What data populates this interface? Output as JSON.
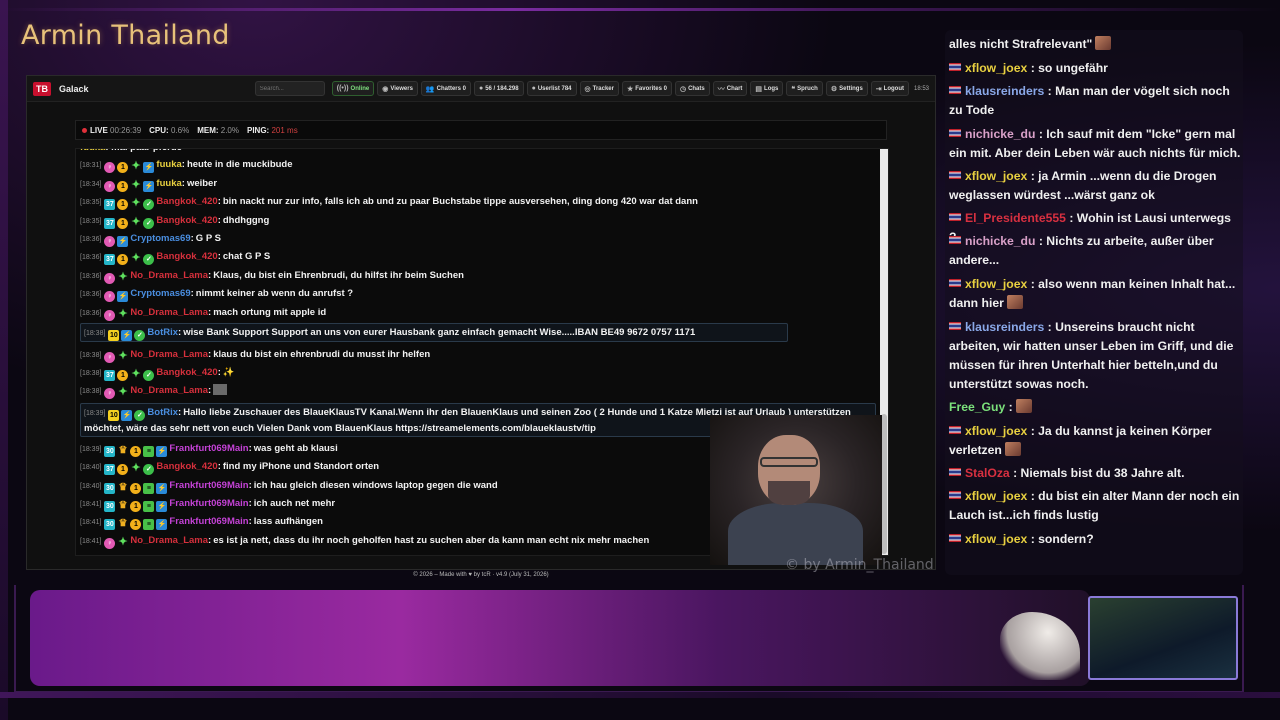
{
  "overlay": {
    "streamer_name": "Armin Thailand",
    "watermark": "© by Armin_Thailand"
  },
  "app": {
    "logo": "TB",
    "name": "Galack",
    "search_placeholder": "Search...",
    "nav": [
      {
        "label": "Online",
        "icon": "signal-icon"
      },
      {
        "label": "Viewers",
        "icon": "eye-icon"
      },
      {
        "label": "Chatters 0",
        "icon": "users-icon"
      },
      {
        "label": "56 / 184.298",
        "icon": "chat-bubble-icon"
      },
      {
        "label": "Userlist 784",
        "icon": "user-icon"
      },
      {
        "label": "Tracker",
        "icon": "target-icon"
      },
      {
        "label": "Favorites 0",
        "icon": "star-icon"
      },
      {
        "label": "Chats",
        "icon": "clock-icon"
      },
      {
        "label": "Chart",
        "icon": "chart-icon"
      },
      {
        "label": "Logs",
        "icon": "doc-icon"
      },
      {
        "label": "Spruch",
        "icon": "quote-icon"
      },
      {
        "label": "Settings",
        "icon": "gear-icon"
      },
      {
        "label": "Logout",
        "icon": "logout-icon"
      }
    ],
    "clock": "18:53",
    "status": {
      "live": "LIVE",
      "uptime": "00:26:39",
      "cpu_label": "CPU:",
      "cpu": "0.6%",
      "mem_label": "MEM:",
      "mem": "2.0%",
      "ping_label": "PING:",
      "ping": "201 ms"
    },
    "footer": "© 2026 – Made with ♥ by tcR · v4.9 (July 31, 2026)"
  },
  "chat": [
    {
      "ts": "[18:31]",
      "user": "fuuka",
      "color": "yellow",
      "text": "heute in die muckibude"
    },
    {
      "ts": "[18:34]",
      "user": "fuuka",
      "color": "yellow",
      "text": "weiber"
    },
    {
      "ts": "[18:35]",
      "user": "Bangkok_420",
      "color": "red",
      "text": "bin nackt nur zur info, falls ich ab und zu paar Buchstabe tippe ausversehen, ding dong 420 war dat dann"
    },
    {
      "ts": "[18:35]",
      "user": "Bangkok_420",
      "color": "red",
      "text": "dhdhggng"
    },
    {
      "ts": "[18:36]",
      "user": "Cryptomas69",
      "color": "blue",
      "text": "G P S"
    },
    {
      "ts": "[18:36]",
      "user": "Bangkok_420",
      "color": "red",
      "text": "chat G P S"
    },
    {
      "ts": "[18:36]",
      "user": "No_Drama_Lama",
      "color": "red",
      "text": "Klaus, du bist ein Ehrenbrudi, du hilfst ihr beim Suchen"
    },
    {
      "ts": "[18:36]",
      "user": "Cryptomas69",
      "color": "blue",
      "text": "nimmt keiner ab wenn du anrufst ?"
    },
    {
      "ts": "[18:36]",
      "user": "No_Drama_Lama",
      "color": "red",
      "text": "mach ortung mit apple id"
    },
    {
      "ts": "[18:38]",
      "user": "BotRix",
      "color": "blue",
      "text": "wise Bank Support Support an uns von eurer Hausbank ganz einfach gemacht Wise.....IBAN BE49 9672 0757 1171"
    },
    {
      "ts": "[18:38]",
      "user": "No_Drama_Lama",
      "color": "red",
      "text": "klaus du bist ein ehrenbrudi du musst ihr helfen"
    },
    {
      "ts": "[18:38]",
      "user": "Bangkok_420",
      "color": "red",
      "text": ""
    },
    {
      "ts": "[18:38]",
      "user": "No_Drama_Lama",
      "color": "red",
      "text": ""
    },
    {
      "ts": "[18:39]",
      "user": "BotRix",
      "color": "blue",
      "text": "Hallo liebe Zuschauer des BlaueKlausTV Kanal.Wenn ihr den BlauenKlaus und seinen Zoo ( 2 Hunde und 1 Katze Mietzi ist auf Urlaub ) unterstützen möchtet, wäre das sehr nett von euch Vielen Dank vom BlauenKlaus https://streamelements.com/blaueklaustv/tip"
    },
    {
      "ts": "[18:39]",
      "user": "Frankfurt069Main",
      "color": "purple",
      "text": "was geht ab klausi"
    },
    {
      "ts": "[18:40]",
      "user": "Bangkok_420",
      "color": "red",
      "text": "find my iPhone und Standort orten"
    },
    {
      "ts": "[18:40]",
      "user": "Frankfurt069Main",
      "color": "purple",
      "text": "ich hau gleich diesen windows laptop gegen die wand"
    },
    {
      "ts": "[18:41]",
      "user": "Frankfurt069Main",
      "color": "purple",
      "text": "ich auch net mehr"
    },
    {
      "ts": "[18:41]",
      "user": "Frankfurt069Main",
      "color": "purple",
      "text": "lass aufhängen"
    },
    {
      "ts": "[18:41]",
      "user": "No_Drama_Lama",
      "color": "red",
      "text": "es ist ja nett, dass du ihr noch geholfen hast zu suchen aber da kann man echt nix mehr machen"
    }
  ],
  "chat_partial_top": {
    "user": "fuuka",
    "text": "mal paar pferde"
  },
  "side_chat": [
    {
      "user": "",
      "text": "alles nicht Strafrelevant\"",
      "emote": true
    },
    {
      "user": "xflow_joex",
      "color": "yellow",
      "text": ": so ungefähr"
    },
    {
      "user": "klausreinders",
      "color": "blue",
      "text": ": Man man der vögelt sich noch zu Tode"
    },
    {
      "user": "nichicke_du",
      "color": "pink",
      "text": ": Ich sauf mit dem \"Icke\" gern mal ein mit. Aber dein Leben wär auch nichts für mich."
    },
    {
      "user": "xflow_joex",
      "color": "yellow",
      "text": ": ja Armin ...wenn du die Drogen weglassen würdest ...wärst ganz ok"
    },
    {
      "user": "El_Presidente555",
      "color": "red",
      "text": ": Wohin ist Lausi unterwegs ?"
    },
    {
      "user": "nichicke_du",
      "color": "pink",
      "text": ": Nichts zu arbeite, außer über andere..."
    },
    {
      "user": "xflow_joex",
      "color": "yellow",
      "text": ": also wenn man keinen Inhalt hat... dann hier",
      "emote": true
    },
    {
      "user": "klausreinders",
      "color": "blue",
      "text": ": Unsereins braucht nicht arbeiten, wir hatten unser Leben im Griff, und die müssen für ihren Unterhalt hier betteln,und du unterstützt sowas noch."
    },
    {
      "user": "Free_Guy",
      "color": "green",
      "text": ":",
      "emote": true
    },
    {
      "user": "xflow_joex",
      "color": "yellow",
      "text": ": Ja du kannst ja keinen Körper verletzen",
      "emote": true
    },
    {
      "user": "StalOza",
      "color": "red",
      "text": ": Niemals bist du 38 Jahre alt."
    },
    {
      "user": "xflow_joex",
      "color": "yellow",
      "text": ": du bist ein alter Mann der noch ein Lauch ist...ich finds lustig"
    },
    {
      "user": "xflow_joex",
      "color": "yellow",
      "text": ": sondern?"
    }
  ]
}
